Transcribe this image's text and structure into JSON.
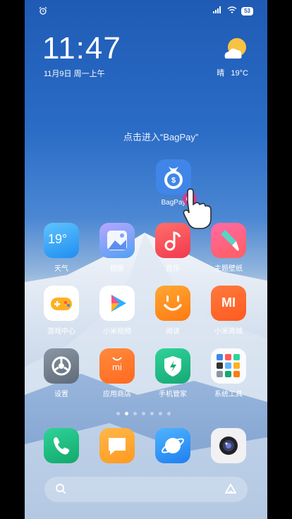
{
  "status": {
    "battery": "53"
  },
  "clock": {
    "time": "11:47",
    "date": "11月9日 周一上午"
  },
  "weather": {
    "condition": "晴",
    "temp": "19°C"
  },
  "hint": "点击进入“BagPay”",
  "bagpay": {
    "label": "BagPay"
  },
  "apps": {
    "weather": {
      "label": "天气",
      "value": "19°"
    },
    "gallery": {
      "label": "相册"
    },
    "music": {
      "label": "音乐"
    },
    "themes": {
      "label": "主题壁纸"
    },
    "games": {
      "label": "游戏中心"
    },
    "video": {
      "label": "小米视频"
    },
    "reader": {
      "label": "阅读"
    },
    "mistore": {
      "label": "小米商城",
      "mark": "MI"
    },
    "settings": {
      "label": "设置"
    },
    "appstore": {
      "label": "应用商店",
      "mark": "mi"
    },
    "security": {
      "label": "手机管家"
    },
    "tools": {
      "label": "系统工具"
    }
  },
  "pager": {
    "count": 7,
    "active": 2
  },
  "colors": {
    "accent": "#3f86e8"
  }
}
